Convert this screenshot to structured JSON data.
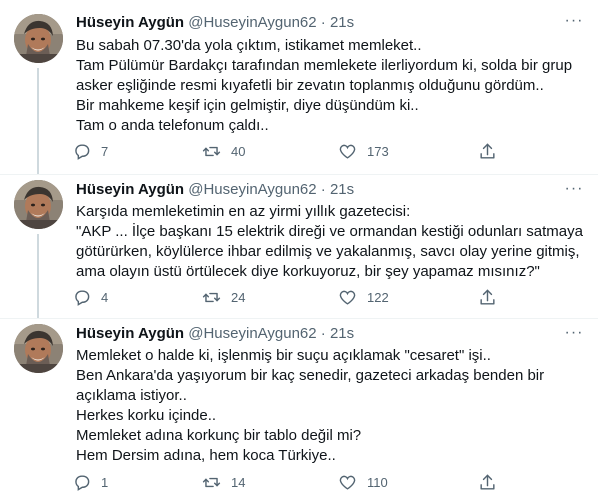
{
  "tweets": [
    {
      "name": "Hüseyin Aygün",
      "handle": "@HuseyinAygun62",
      "separator": "·",
      "time": "21s",
      "more": "···",
      "lines": [
        "Bu sabah 07.30'da yola çıktım, istikamet memleket..",
        "Tam Pülümür Bardakçı tarafından memlekete ilerliyordum  ki, solda bir grup",
        "asker eşliğinde resmi kıyafetli bir zevatın toplanmış olduğunu gördüm..",
        "Bir mahkeme keşif için gelmiştir, diye düşündüm ki..",
        "Tam o anda telefonum çaldı.."
      ],
      "replies": "7",
      "retweets": "40",
      "likes": "173"
    },
    {
      "name": "Hüseyin Aygün",
      "handle": "@HuseyinAygun62",
      "separator": "·",
      "time": "21s",
      "more": "···",
      "lines": [
        "Karşıda memleketimin en az yirmi yıllık gazetecisi:",
        "\"AKP ... İlçe başkanı 15 elektrik direği ve ormandan kestiği odunları satmaya",
        "götürürken, köylülerce ihbar edilmiş ve yakalanmış, savcı olay yerine gitmiş,",
        "ama olayın üstü örtülecek diye korkuyoruz, bir şey yapamaz mısınız?\""
      ],
      "replies": "4",
      "retweets": "24",
      "likes": "122"
    },
    {
      "name": "Hüseyin Aygün",
      "handle": "@HuseyinAygun62",
      "separator": "·",
      "time": "21s",
      "more": "···",
      "lines": [
        "Memleket o halde ki, işlenmiş bir suçu açıklamak \"cesaret\" işi..",
        "Ben Ankara'da yaşıyorum bir kaç senedir, gazeteci arkadaş benden bir",
        "açıklama istiyor..",
        "Herkes korku içinde..",
        "Memleket adına korkunç bir tablo değil mi?",
        "Hem Dersim adına, hem koca Türkiye.."
      ],
      "replies": "1",
      "retweets": "14",
      "likes": "110"
    }
  ],
  "icons": {
    "reply": "reply-icon",
    "retweet": "retweet-icon",
    "like": "heart-icon",
    "share": "share-icon",
    "more": "more-options-icon"
  },
  "colors": {
    "text": "#0f1419",
    "secondary": "#536471",
    "thread_line": "#cfd9de",
    "divider": "#eff3f4"
  }
}
